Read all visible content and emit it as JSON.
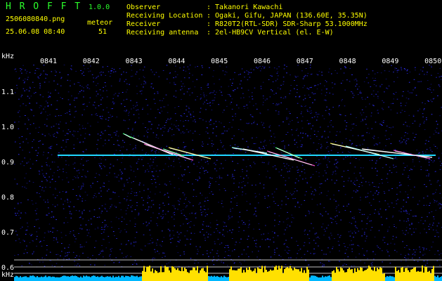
{
  "app": {
    "name": "H R O F F T",
    "version": "1.0.0",
    "filename": "2506080840.png",
    "datetime": "25.06.08 08:40",
    "meteor_label": "meteor",
    "meteor_count": "51"
  },
  "info": {
    "rows": [
      {
        "label": "Observer",
        "value": ": Takanori Kawachi"
      },
      {
        "label": "Receiving Location",
        "value": ": Ogaki, Gifu, JAPAN (136.60E, 35.35N)"
      },
      {
        "label": "Receiver",
        "value": ": R820T2(RTL-SDR) SDR-Sharp 53.1000MHz"
      },
      {
        "label": "Receiving antenna",
        "value": ": 2el-HB9CV Vertical (el. E-W)"
      }
    ]
  },
  "spectrogram": {
    "unit": "kHz",
    "time_ticks": [
      "0841",
      "0842",
      "0843",
      "0844",
      "0845",
      "0846",
      "0847",
      "0848",
      "0849",
      "0850"
    ],
    "freq_ticks": [
      {
        "label": "1.1",
        "value": 1.1
      },
      {
        "label": "1.0",
        "value": 1.0
      },
      {
        "label": "0.9",
        "value": 0.9
      },
      {
        "label": "0.8",
        "value": 0.8
      },
      {
        "label": "0.7",
        "value": 0.7
      },
      {
        "label": "0.6",
        "value": 0.6
      }
    ],
    "bottom_unit": "kHz",
    "bottom_freq_label": "0.6",
    "carrier_freq_khz": 0.92,
    "colors": {
      "background": "#000000",
      "noise": "#1a1aa0",
      "carrier": "#20d8ff",
      "meteor": "#ffffff",
      "level_bar": "#ffe000",
      "level_base": "#00b8ff",
      "axis_text": "#ffffff"
    }
  }
}
